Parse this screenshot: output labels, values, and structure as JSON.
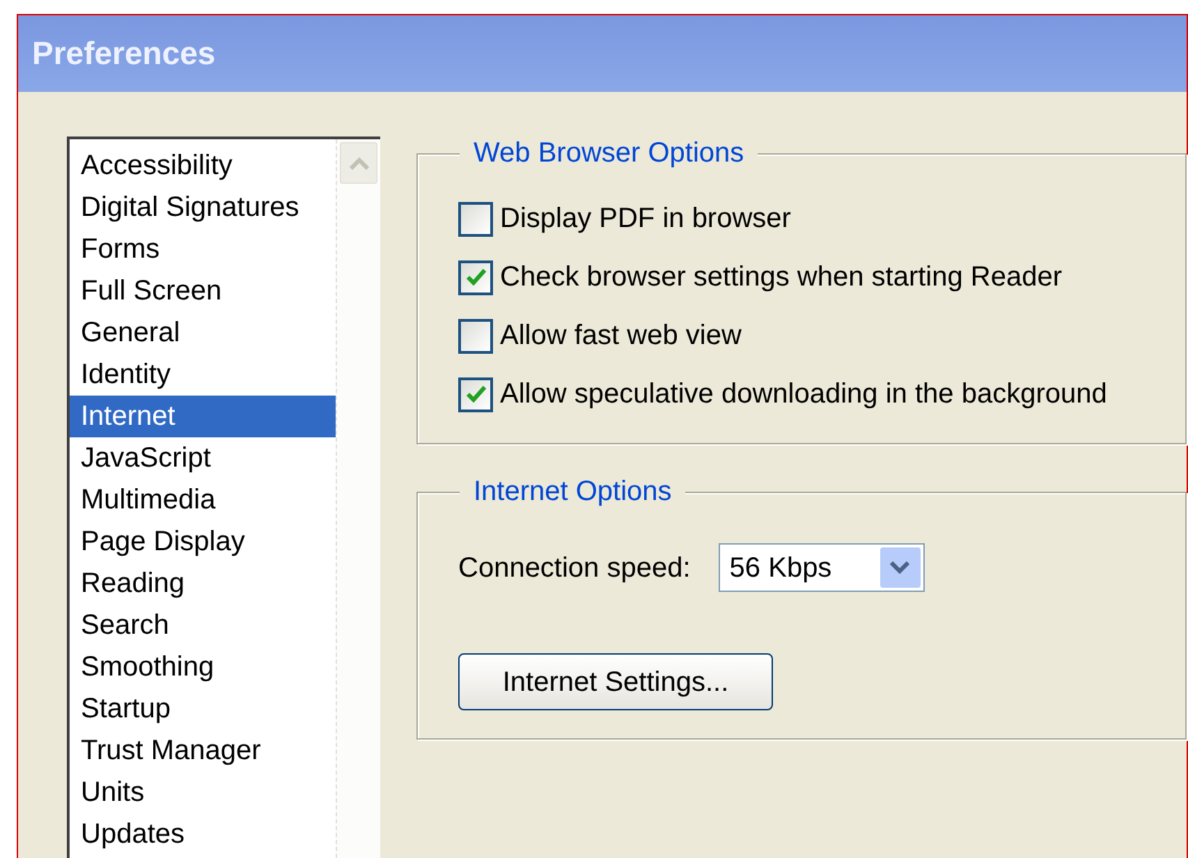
{
  "window": {
    "title": "Preferences"
  },
  "categories": [
    {
      "label": "Accessibility",
      "selected": false
    },
    {
      "label": "Digital Signatures",
      "selected": false
    },
    {
      "label": "Forms",
      "selected": false
    },
    {
      "label": "Full Screen",
      "selected": false
    },
    {
      "label": "General",
      "selected": false
    },
    {
      "label": "Identity",
      "selected": false
    },
    {
      "label": "Internet",
      "selected": true
    },
    {
      "label": "JavaScript",
      "selected": false
    },
    {
      "label": "Multimedia",
      "selected": false
    },
    {
      "label": "Page Display",
      "selected": false
    },
    {
      "label": "Reading",
      "selected": false
    },
    {
      "label": "Search",
      "selected": false
    },
    {
      "label": "Smoothing",
      "selected": false
    },
    {
      "label": "Startup",
      "selected": false
    },
    {
      "label": "Trust Manager",
      "selected": false
    },
    {
      "label": "Units",
      "selected": false
    },
    {
      "label": "Updates",
      "selected": false
    }
  ],
  "web_browser_options": {
    "title": "Web Browser Options",
    "options": [
      {
        "label": "Display PDF in browser",
        "checked": false
      },
      {
        "label": "Check browser settings when starting Reader",
        "checked": true
      },
      {
        "label": "Allow fast web view",
        "checked": false
      },
      {
        "label": "Allow speculative downloading in the background",
        "checked": true
      }
    ]
  },
  "internet_options": {
    "title": "Internet Options",
    "connection_speed": {
      "label": "Connection speed:",
      "value": "56 Kbps"
    },
    "button": "Internet Settings..."
  }
}
